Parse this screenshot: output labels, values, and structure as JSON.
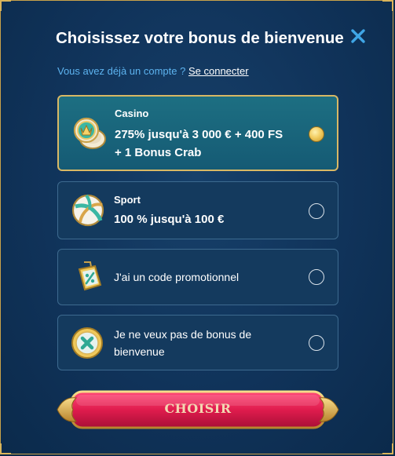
{
  "modal": {
    "title": "Choisissez votre bonus de bienvenue",
    "close_icon": "close-icon",
    "login_prompt": "Vous avez déjà un compte ?",
    "login_link": "Se connecter"
  },
  "options": [
    {
      "icon": "casino-chip-icon",
      "title": "Casino",
      "desc_line1": "275% jusqu'à 3 000 € + 400 FS",
      "desc_line2": "+ 1 Bonus Crab",
      "selected": true
    },
    {
      "icon": "volleyball-icon",
      "title": "Sport",
      "desc_line1": "100 % jusqu'à 100 €",
      "selected": false
    },
    {
      "icon": "promo-tag-icon",
      "text_line1": "J'ai un code promotionnel",
      "selected": false
    },
    {
      "icon": "no-bonus-icon",
      "text_line1": "Je ne veux pas de bonus de",
      "text_line2": "bienvenue",
      "selected": false
    }
  ],
  "submit": {
    "label": "CHOISIR"
  },
  "colors": {
    "accent_link": "#5db3ef",
    "gold": "#d8b865",
    "selected_bg": "#1d6f82",
    "button": "#e01c4e"
  }
}
